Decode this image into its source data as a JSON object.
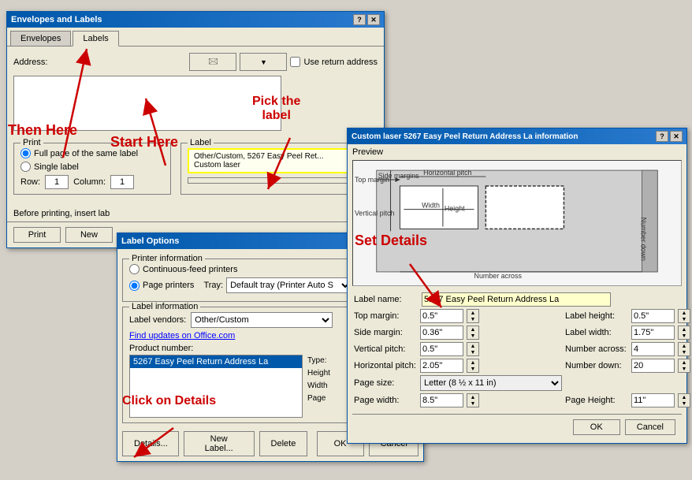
{
  "envelopes_dialog": {
    "title": "Envelopes and Labels",
    "tabs": [
      "Envelopes",
      "Labels"
    ],
    "active_tab": "Labels",
    "address_label": "Address:",
    "use_return_address": "Use return address",
    "print_section": {
      "title": "Print",
      "options": [
        "Full page of the same label",
        "Single label"
      ],
      "selected": "Full page of the same label",
      "row_label": "Row:",
      "row_value": "1",
      "col_label": "Column:",
      "col_value": "1"
    },
    "label_section": {
      "title": "Label",
      "line1": "Other/Custom, 5267 Easy Peel Ret...",
      "line2": "Custom laser"
    },
    "insert_label": "Before printing, insert lab",
    "buttons": {
      "print": "Print",
      "new": "New"
    }
  },
  "label_options_dialog": {
    "title": "Label Options",
    "printer_info": {
      "title": "Printer information",
      "options": [
        "Continuous-feed printers",
        "Page printers"
      ],
      "selected": "Page printers",
      "tray_label": "Tray:",
      "tray_value": "Default tray (Printer Auto S"
    },
    "label_info": {
      "title": "Label information",
      "vendor_label": "Label vendors:",
      "vendor_value": "Other/Custom",
      "find_updates": "Find updates on Office.com",
      "product_label": "Product number:",
      "product_items": [
        "5267 Easy Peel Return Address La"
      ],
      "selected_product": "5267 Easy Peel Return Address La",
      "type_label": "Type:",
      "height_label": "Height",
      "width_label": "Width",
      "page_size_label": "Page"
    },
    "buttons": {
      "details": "Details...",
      "new_label": "New Label...",
      "delete": "Delete",
      "ok": "OK",
      "cancel": "Cancel"
    }
  },
  "custom_info_dialog": {
    "title": "Custom laser 5267 Easy Peel Return Address La information",
    "preview_label": "Preview",
    "diagram": {
      "side_margins": "Side margins",
      "top_margin": "Top margin",
      "horizontal_pitch": "Horizontal pitch",
      "vertical_pitch": "Vertical pitch",
      "width": "Width",
      "height": "Height",
      "number_across": "Number across",
      "number_down": "Number down"
    },
    "fields": {
      "label_name_label": "Label name:",
      "label_name_value": "5267 Easy Peel Return Address La",
      "top_margin_label": "Top margin:",
      "top_margin_value": "0.5\"",
      "label_height_label": "Label height:",
      "label_height_value": "0.5\"",
      "side_margin_label": "Side margin:",
      "side_margin_value": "0.36\"",
      "label_width_label": "Label width:",
      "label_width_value": "1.75\"",
      "vertical_pitch_label": "Vertical pitch:",
      "vertical_pitch_value": "0.5\"",
      "number_across_label": "Number across:",
      "number_across_value": "4",
      "horizontal_pitch_label": "Horizontal pitch:",
      "horizontal_pitch_value": "2.05\"",
      "number_down_label": "Number down:",
      "number_down_value": "20",
      "page_size_label": "Page size:",
      "page_size_value": "Letter (8 ½ x 11 in)",
      "page_width_label": "Page width:",
      "page_width_value": "8.5\"",
      "page_height_label": "Page Height:",
      "page_height_value": "11\""
    },
    "buttons": {
      "ok": "OK",
      "cancel": "Cancel"
    }
  },
  "annotations": {
    "then_here": "Then Here",
    "start_here": "Start Here",
    "pick_label": "Pick the\nlabel",
    "set_details": "Set Details",
    "click_details": "Click on Details"
  }
}
